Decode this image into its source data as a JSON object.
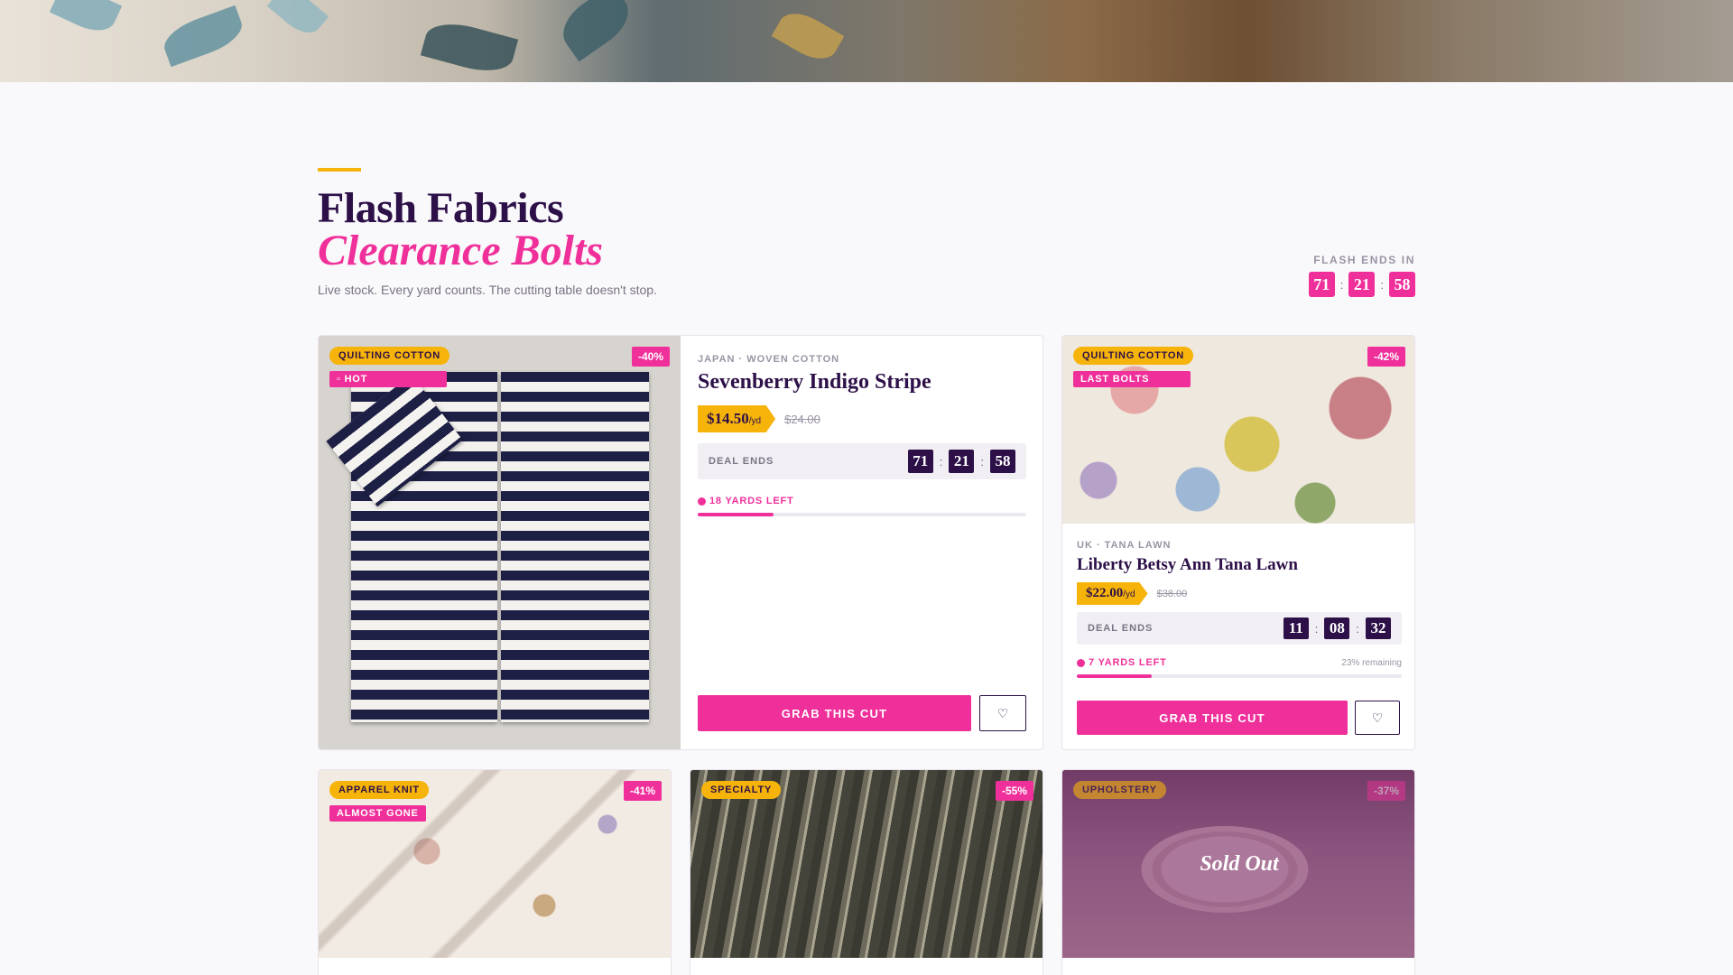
{
  "colors": {
    "accent_pink": "#f0309a",
    "accent_gold": "#f6b30a",
    "plum": "#2d1048",
    "background": "#f9f8fa"
  },
  "header": {
    "title_line1": "Flash Fabrics",
    "title_line2": "Clearance Bolts",
    "subtitle": "Live stock. Every yard counts. The cutting table doesn't stop.",
    "flash_label": "FLASH ENDS IN",
    "flash_timer": [
      "71",
      "21",
      "58"
    ],
    "timer_separator": ":"
  },
  "featured": {
    "category": "QUILTING COTTON",
    "flag": "HOT",
    "flag_icon": "flame-icon",
    "discount": "-40%",
    "origin": "JAPAN · WOVEN COTTON",
    "name": "Sevenberry Indigo Stripe",
    "price": "$14.50",
    "unit": "/yd",
    "old_price": "$24.00",
    "deal_label": "DEAL ENDS",
    "deal_timer": [
      "71",
      "21",
      "58"
    ],
    "stock": "18 YARDS LEFT",
    "stock_fraction": 0.23,
    "button": "GRAB THIS CUT",
    "wishlist_icon": "heart-icon"
  },
  "liberty": {
    "category": "QUILTING COTTON",
    "flag": "LAST BOLTS",
    "discount": "-42%",
    "origin": "UK · TANA LAWN",
    "name": "Liberty Betsy Ann Tana Lawn",
    "price": "$22.00",
    "unit": "/yd",
    "old_price": "$38.00",
    "deal_label": "DEAL ENDS",
    "deal_timer": [
      "11",
      "08",
      "32"
    ],
    "stock": "7 YARDS LEFT",
    "remaining": "23% remaining",
    "stock_fraction": 0.23,
    "button": "GRAB THIS CUT",
    "wishlist_icon": "heart-icon"
  },
  "row2": [
    {
      "category": "APPAREL KNIT",
      "flag": "ALMOST GONE",
      "discount": "-41%"
    },
    {
      "category": "SPECIALTY",
      "flag": "",
      "discount": "-55%"
    },
    {
      "category": "UPHOLSTERY",
      "flag": "",
      "discount": "-37%",
      "overlay": "Sold Out"
    }
  ]
}
